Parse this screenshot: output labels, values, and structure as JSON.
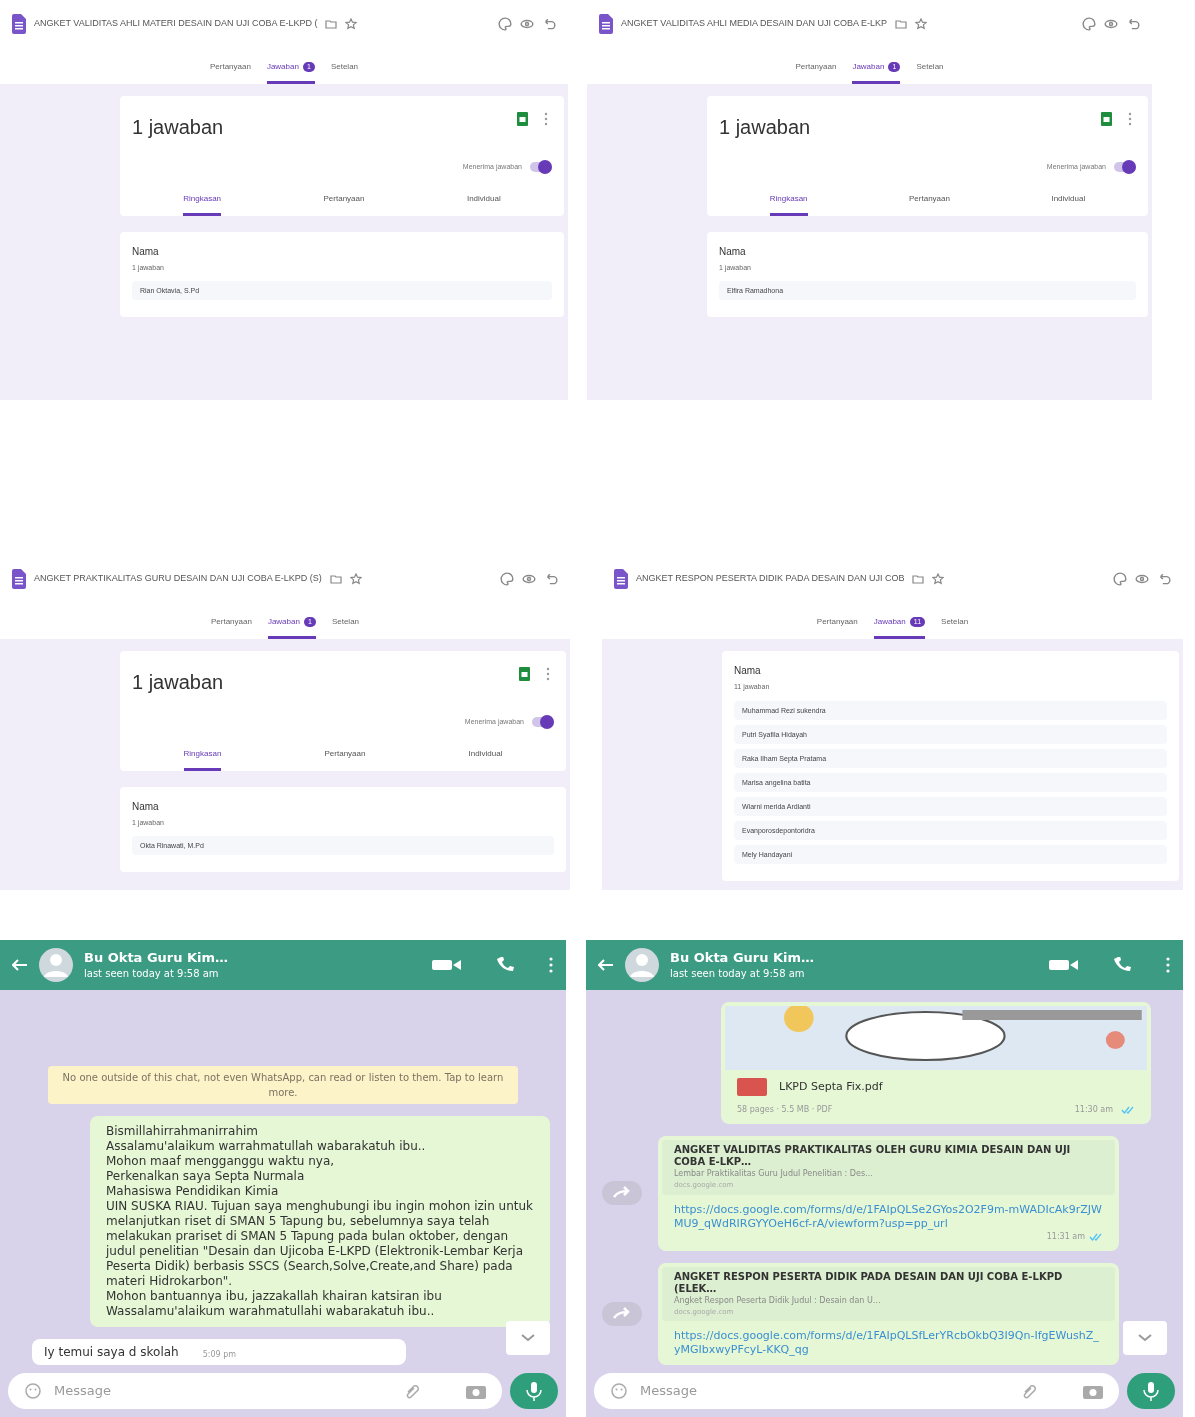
{
  "forms": [
    {
      "title": "ANGKET VALIDITAS AHLI MATERI DESAIN DAN UJI COBA E-LKPD (",
      "tabs": [
        {
          "label": "Pertanyaan",
          "selected": false
        },
        {
          "label": "Jawaban",
          "selected": true,
          "badge": "1"
        },
        {
          "label": "Setelan",
          "selected": false
        }
      ],
      "summary": {
        "count": "1 jawaban",
        "accepting": {
          "label": "Menerima jawaban",
          "on": true
        },
        "subtabs": [
          {
            "label": "Ringkasan",
            "selected": true
          },
          {
            "label": "Pertanyaan",
            "selected": false
          },
          {
            "label": "Individual",
            "selected": false
          }
        ]
      },
      "question": {
        "label": "Nama",
        "count": "1 jawaban",
        "answers": [
          "Rian Oktavia, S.Pd"
        ]
      }
    },
    {
      "title": "ANGKET VALIDITAS AHLI MEDIA DESAIN DAN UJI COBA E-LKP",
      "tabs": [
        {
          "label": "Pertanyaan",
          "selected": false
        },
        {
          "label": "Jawaban",
          "selected": true,
          "badge": "1"
        },
        {
          "label": "Setelan",
          "selected": false
        }
      ],
      "summary": {
        "count": "1 jawaban",
        "accepting": {
          "label": "Menerima jawaban",
          "on": true
        },
        "subtabs": [
          {
            "label": "Ringkasan",
            "selected": true
          },
          {
            "label": "Pertanyaan",
            "selected": false
          },
          {
            "label": "Individual",
            "selected": false
          }
        ]
      },
      "question": {
        "label": "Nama",
        "count": "1 jawaban",
        "answers": [
          "Elfira Ramadhona"
        ]
      }
    },
    {
      "title": "ANGKET PRAKTIKALITAS GURU DESAIN DAN UJI COBA E-LKPD (S)",
      "tabs": [
        {
          "label": "Pertanyaan",
          "selected": false
        },
        {
          "label": "Jawaban",
          "selected": true,
          "badge": "1"
        },
        {
          "label": "Setelan",
          "selected": false
        }
      ],
      "summary": {
        "count": "1 jawaban",
        "accepting": {
          "label": "Menerima jawaban",
          "on": true
        },
        "subtabs": [
          {
            "label": "Ringkasan",
            "selected": true
          },
          {
            "label": "Pertanyaan",
            "selected": false
          },
          {
            "label": "Individual",
            "selected": false
          }
        ]
      },
      "question": {
        "label": "Nama",
        "count": "1 jawaban",
        "answers": [
          "Okta Rinawati, M.Pd"
        ]
      }
    },
    {
      "title": "ANGKET RESPON PESERTA DIDIK PADA DESAIN DAN UJI COB",
      "tabs": [
        {
          "label": "Pertanyaan",
          "selected": false
        },
        {
          "label": "Jawaban",
          "selected": true,
          "badge": "11"
        },
        {
          "label": "Setelan",
          "selected": false
        }
      ],
      "question": {
        "label": "Nama",
        "count": "11 jawaban",
        "answers": [
          "Muhammad Rezi sukendra",
          "Putri Syafila Hidayah",
          "Raka Ilham Septa Pratama",
          "Marisa angelina batita",
          "Wiarni merida Ardianti",
          "Evanporosdepontoridra",
          "Mely Handayani"
        ]
      }
    }
  ],
  "chats": [
    {
      "contact": "Bu Okta Guru Kim…",
      "status": "last seen today at 9:58 am",
      "messages": [
        {
          "kind": "notice",
          "text": "No one outside of this chat, not even WhatsApp, can read or listen to them. Tap to learn more."
        },
        {
          "kind": "outgoing",
          "text": "Bismillahirrahmanirrahim\nAssalamu'alaikum warrahmatullah wabarakatuh ibu..\nMohon maaf mengganggu waktu nya,\nPerkenalkan saya Septa Nurmala\nMahasiswa Pendidikan Kimia\nUIN SUSKA RIAU. Tujuan saya menghubungi ibu ingin mohon izin untuk melanjutkan  riset di SMAN 5 Tapung bu, sebelumnya saya telah melakukan prariset di SMAN 5 Tapung pada bulan oktober, dengan judul penelitian \"Desain dan Ujicoba E-LKPD (Elektronik-Lembar Kerja Peserta Didik) berbasis SSCS (Search,Solve,Create,and Share) pada materi Hidrokarbon\".\nMohon bantuannya ibu, jazzakallah khairan katsiran ibu\nWassalamu'alaikum warahmatullahi wabarakatuh ibu.."
        },
        {
          "kind": "incoming",
          "text": "Iy temui saya d skolah",
          "time": "5:09 pm"
        }
      ],
      "placeholder": "Message"
    },
    {
      "contact": "Bu Okta Guru Kim…",
      "status": "last seen today at 9:58 am",
      "messages": [
        {
          "kind": "document",
          "name": "LKPD Septa Fix.pdf",
          "meta": "58 pages · 5.5 MB · PDF",
          "time": "11:30 am"
        },
        {
          "kind": "link",
          "title": "ANGKET VALIDITAS PRAKTIKALITAS OLEH GURU KIMIA DESAIN DAN UJI COBA E-LKP…",
          "description": "Lembar Praktikalitas Guru Judul Penelitian : Des…",
          "domain": "docs.google.com",
          "url": "https://docs.google.com/forms/d/e/1FAIpQLSe2GYos2O2F9m-mWADIcAk9rZJWMU9_qWdRIRGYYOeH6cf-rA/viewform?usp=pp_url",
          "time": "11:31 am"
        },
        {
          "kind": "link",
          "title": "ANGKET RESPON PESERTA DIDIK PADA DESAIN DAN UJI COBA E-LKPD (ELEK…",
          "description": "Angket Respon Peserta Didik Judul : Desain dan U…",
          "domain": "docs.google.com",
          "url": "https://docs.google.com/forms/d/e/1FAIpQLSfLerYRcbOkbQ3I9Qn-IfgEWushZ_yMGIbxwyPFcyL-KKQ_qg"
        }
      ],
      "placeholder": "Message"
    }
  ]
}
